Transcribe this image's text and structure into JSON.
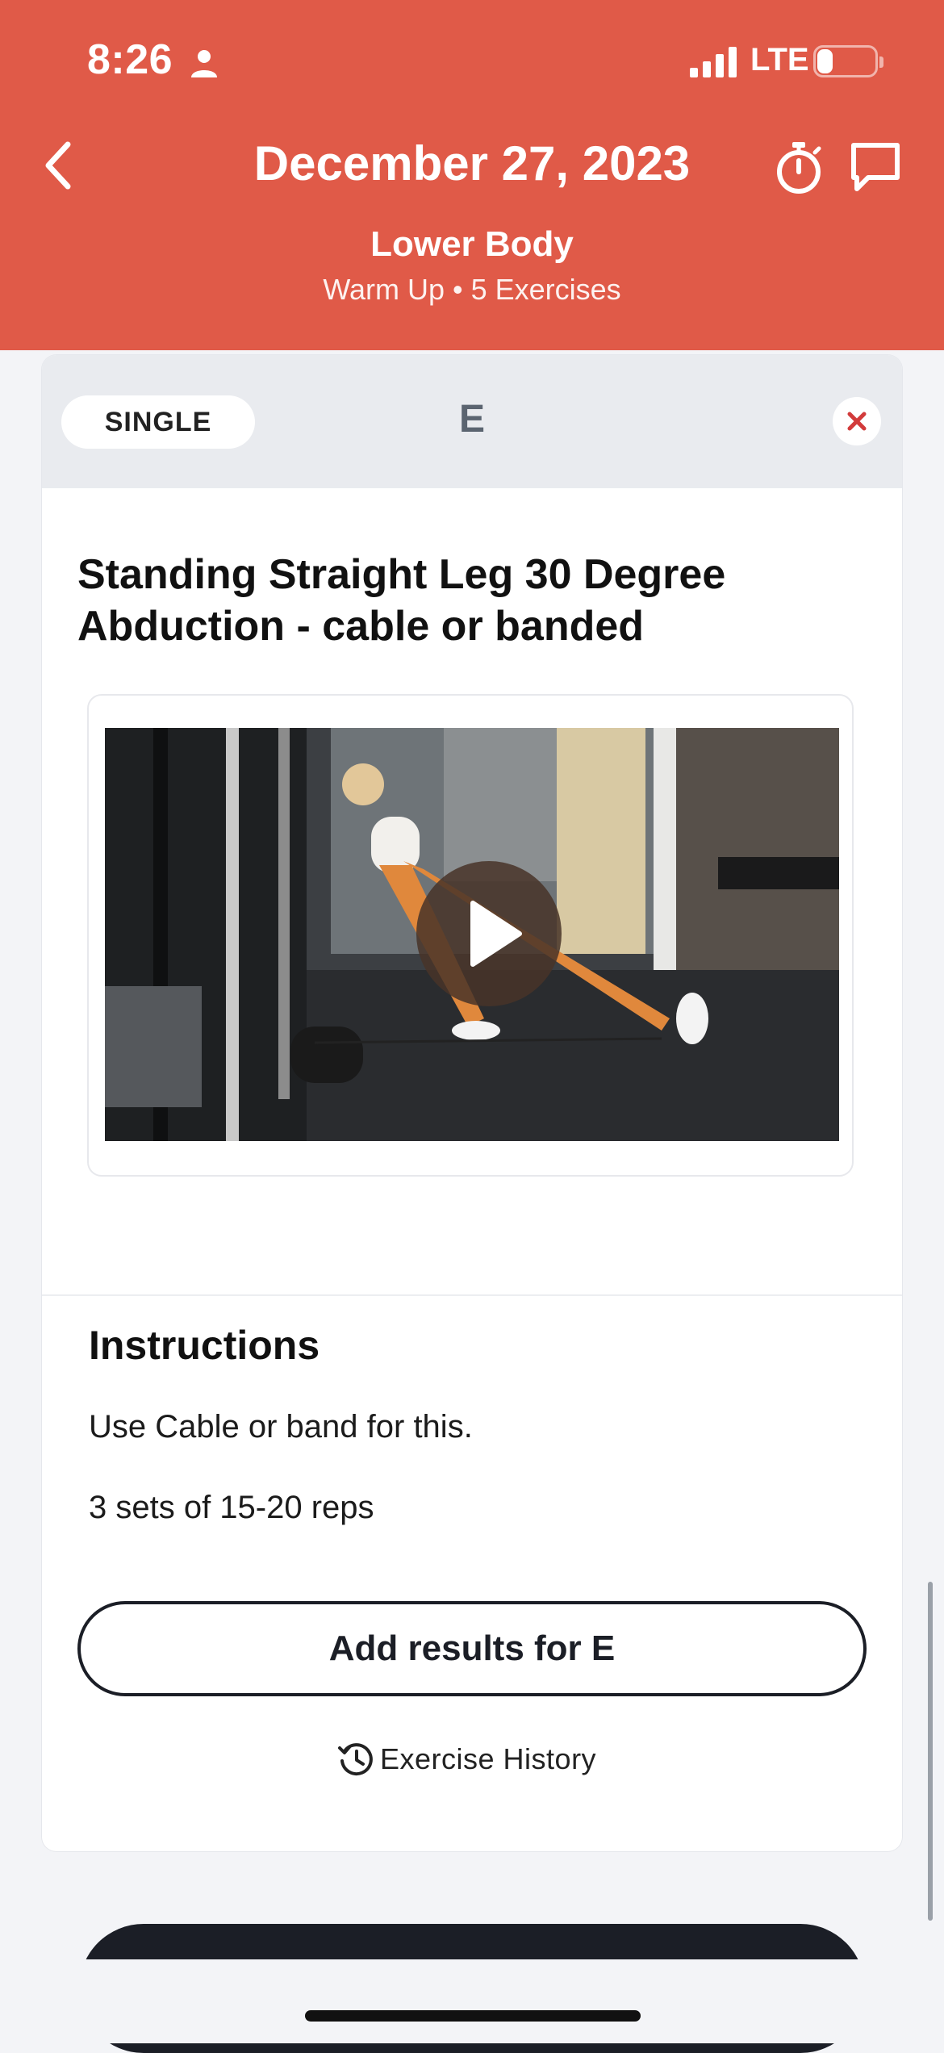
{
  "status_bar": {
    "time": "8:26",
    "network": "LTE",
    "battery_level": "27",
    "battery_fraction": 0.27
  },
  "header": {
    "title": "December 27, 2023",
    "subtitle": "Lower Body",
    "meta": "Warm Up • 5 Exercises",
    "icons": [
      "back-chevron-icon",
      "stopwatch-icon",
      "chat-bubble-icon"
    ]
  },
  "colors": {
    "header_bg": "#e05a48",
    "page_bg": "#f3f4f7",
    "button_dark": "#1b1e26",
    "close_red": "#d23b3b"
  },
  "card": {
    "type_label": "SINGLE",
    "letter": "E",
    "exercise_title": "Standing Straight Leg 30 Degree Abduction - cable or banded",
    "instructions_title": "Instructions",
    "instructions": [
      "Use Cable or band for this.",
      "3 sets of 15-20 reps"
    ],
    "add_results_label": "Add results for E",
    "history_label": "Exercise History"
  }
}
